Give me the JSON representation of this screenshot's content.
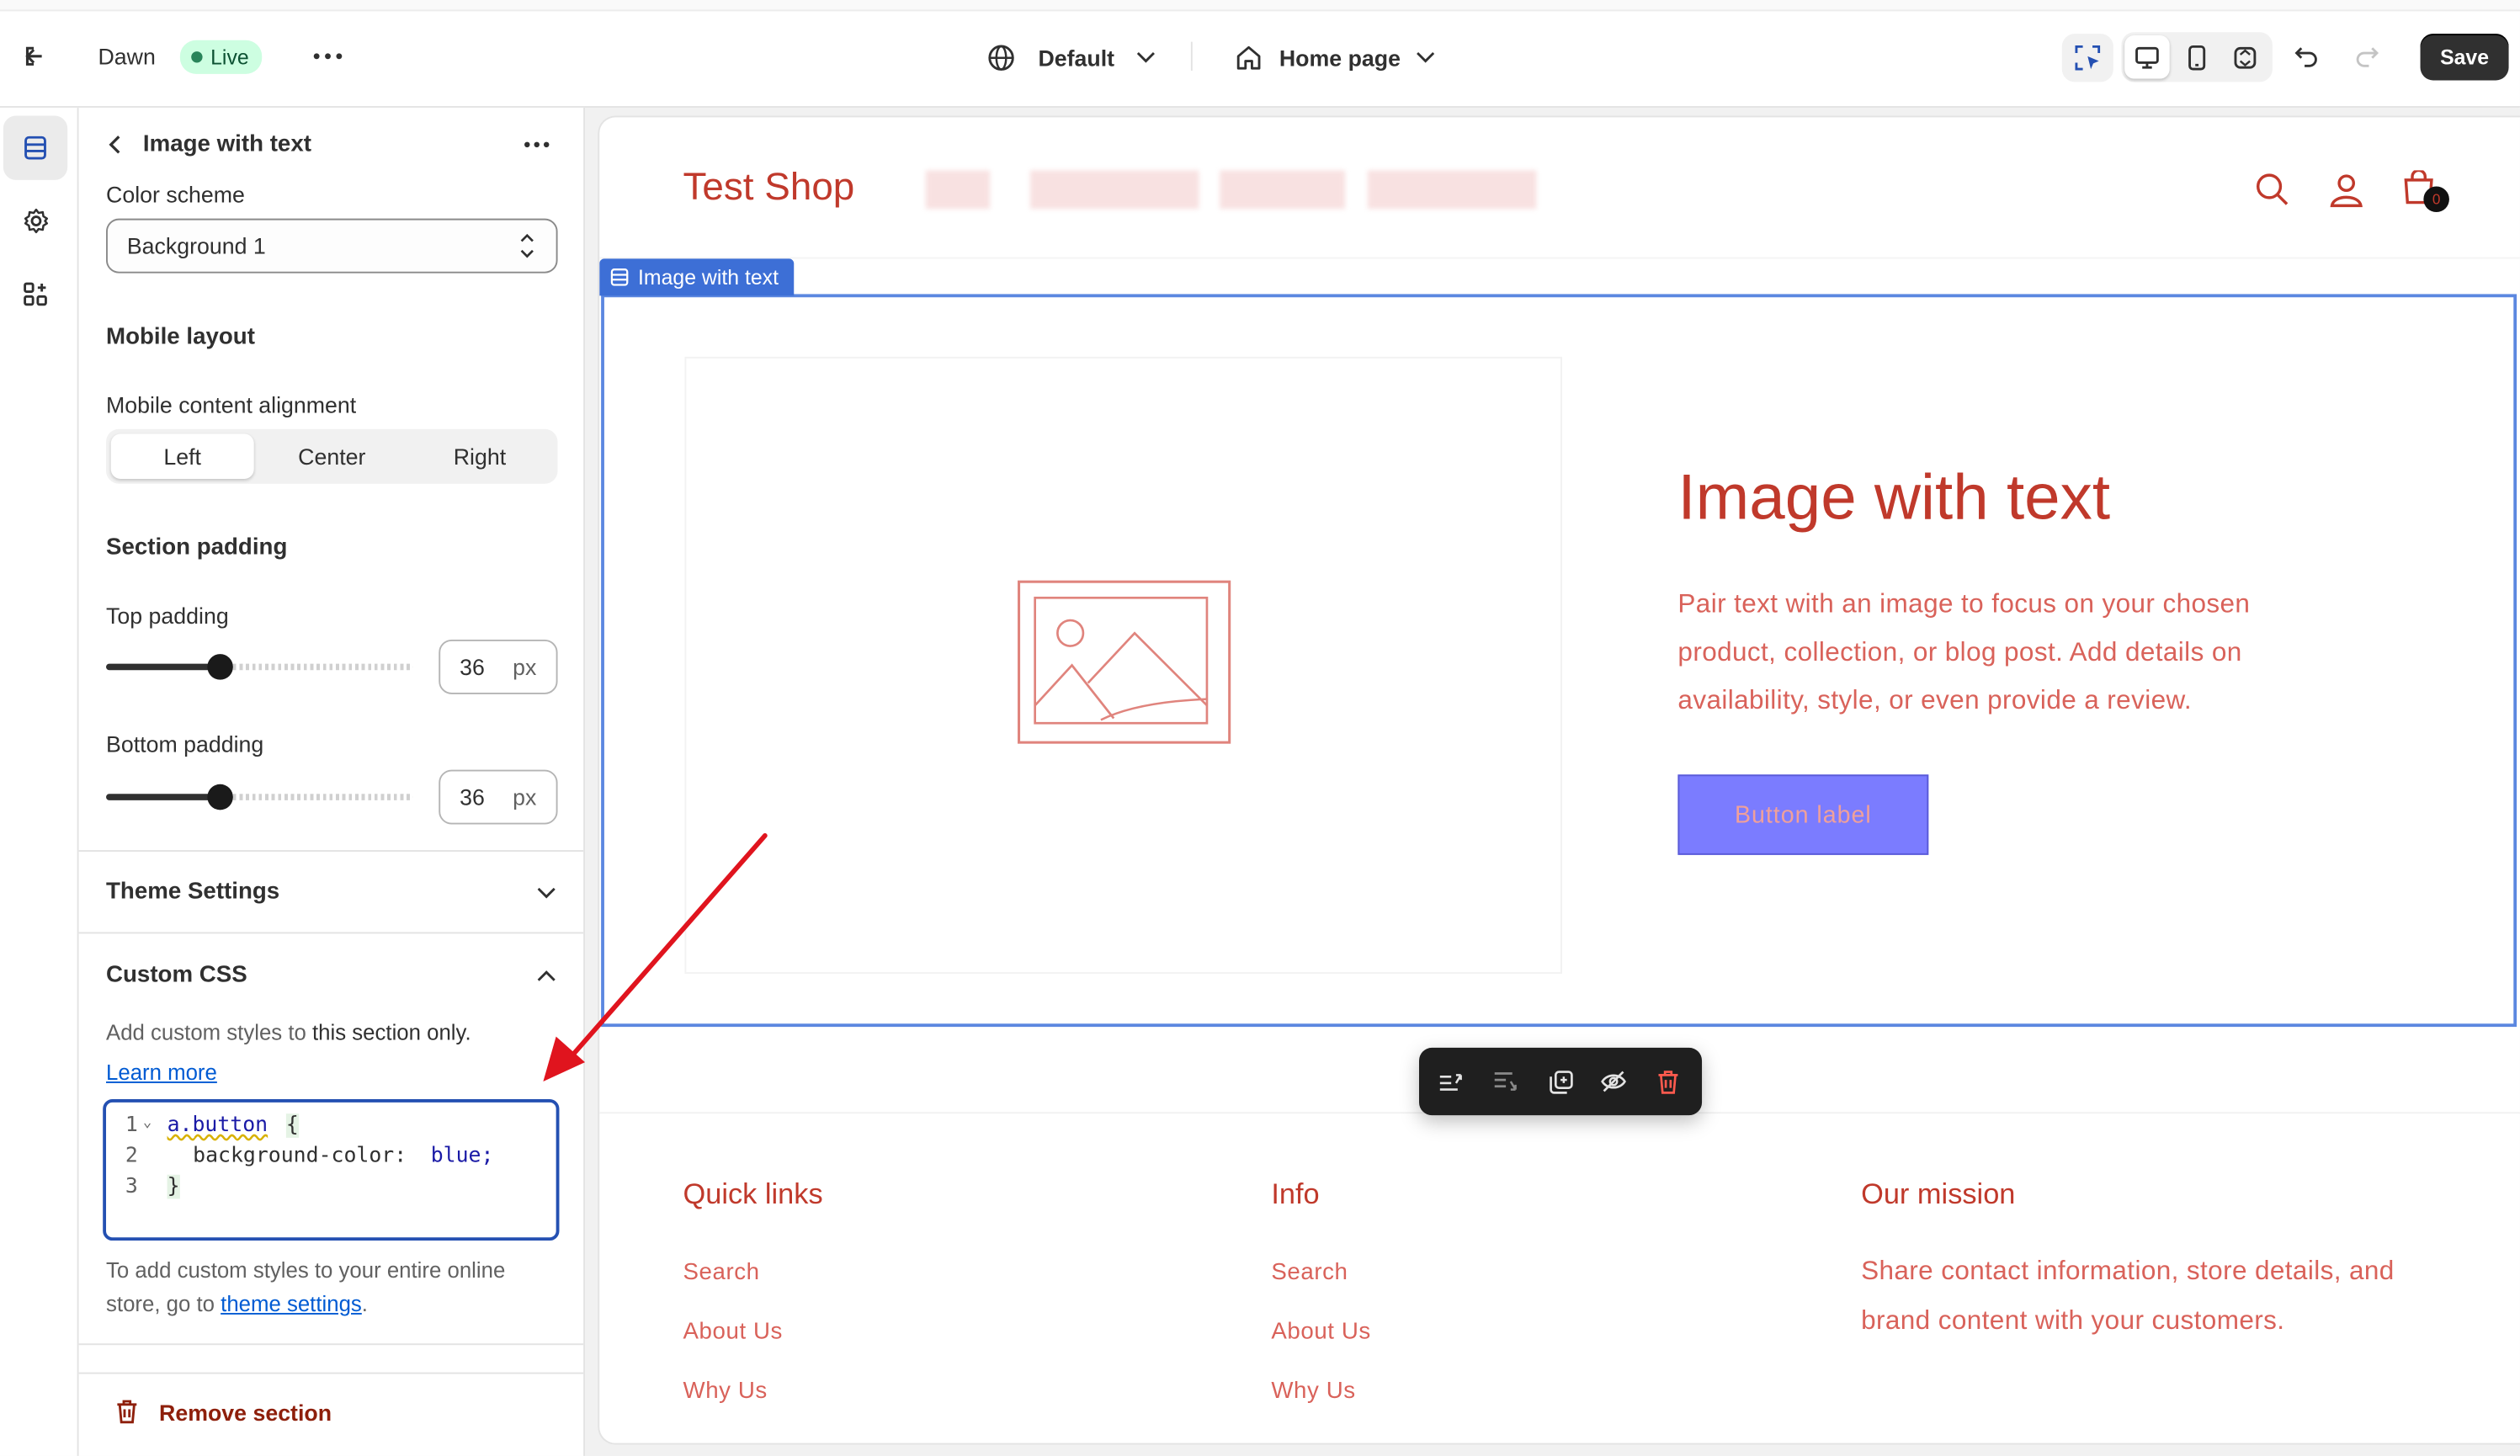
{
  "topbar": {
    "theme_name": "Dawn",
    "live_badge": "Live",
    "more_icon": "ellipsis-icon",
    "language_selector": "Default",
    "page_selector": "Home page",
    "save_label": "Save"
  },
  "sidebar_rail": {
    "items": [
      "sections-icon",
      "settings-gear-icon",
      "apps-icon"
    ]
  },
  "panel": {
    "title": "Image with text",
    "color_scheme_label": "Color scheme",
    "color_scheme_value": "Background 1",
    "mobile_layout_heading": "Mobile layout",
    "mobile_alignment_label": "Mobile content alignment",
    "alignment_options": [
      "Left",
      "Center",
      "Right"
    ],
    "alignment_selected": "Left",
    "section_padding_heading": "Section padding",
    "top_padding_label": "Top padding",
    "top_padding_value": "36",
    "top_padding_unit": "px",
    "bottom_padding_label": "Bottom padding",
    "bottom_padding_value": "36",
    "bottom_padding_unit": "px",
    "theme_settings_heading": "Theme Settings",
    "custom_css_heading": "Custom CSS",
    "custom_css_desc_prefix": "Add custom styles to ",
    "custom_css_desc_bold": "this section only.",
    "learn_more": "Learn more",
    "code_lines": [
      {
        "num": "1",
        "text": "a.button {"
      },
      {
        "num": "2",
        "text": "  background-color: blue;"
      },
      {
        "num": "3",
        "text": "}"
      }
    ],
    "code_line1_selector": "a.button",
    "code_line1_brace": "{",
    "code_line2_prop": "background-color:",
    "code_line2_value": "blue;",
    "code_line3": "}",
    "footer_note_prefix": "To add custom styles to your entire online store, go to ",
    "footer_note_link": "theme settings",
    "footer_note_suffix": ".",
    "remove_section": "Remove section"
  },
  "preview": {
    "shop_name": "Test Shop",
    "cart_count": "0",
    "section_tag": "Image with text",
    "heading": "Image with text",
    "body_line1": "Pair text with an image to focus on your chosen",
    "body_line2": "product, collection, or blog post. Add details on",
    "body_line3": "availability, style, or even provide a review.",
    "button_label": "Button label",
    "footer": {
      "quick_links_heading": "Quick links",
      "quick_links": [
        "Search",
        "About Us",
        "Why Us"
      ],
      "info_heading": "Info",
      "info_links": [
        "Search",
        "About Us",
        "Why Us"
      ],
      "mission_heading": "Our mission",
      "mission_line1": "Share contact information, store details, and",
      "mission_line2": "brand content with your customers."
    }
  },
  "colors": {
    "accent_blue": "#2450b2",
    "shop_red": "#c0392b",
    "button_fill": "#7b7cff",
    "annotation_arrow": "#e0141e"
  }
}
